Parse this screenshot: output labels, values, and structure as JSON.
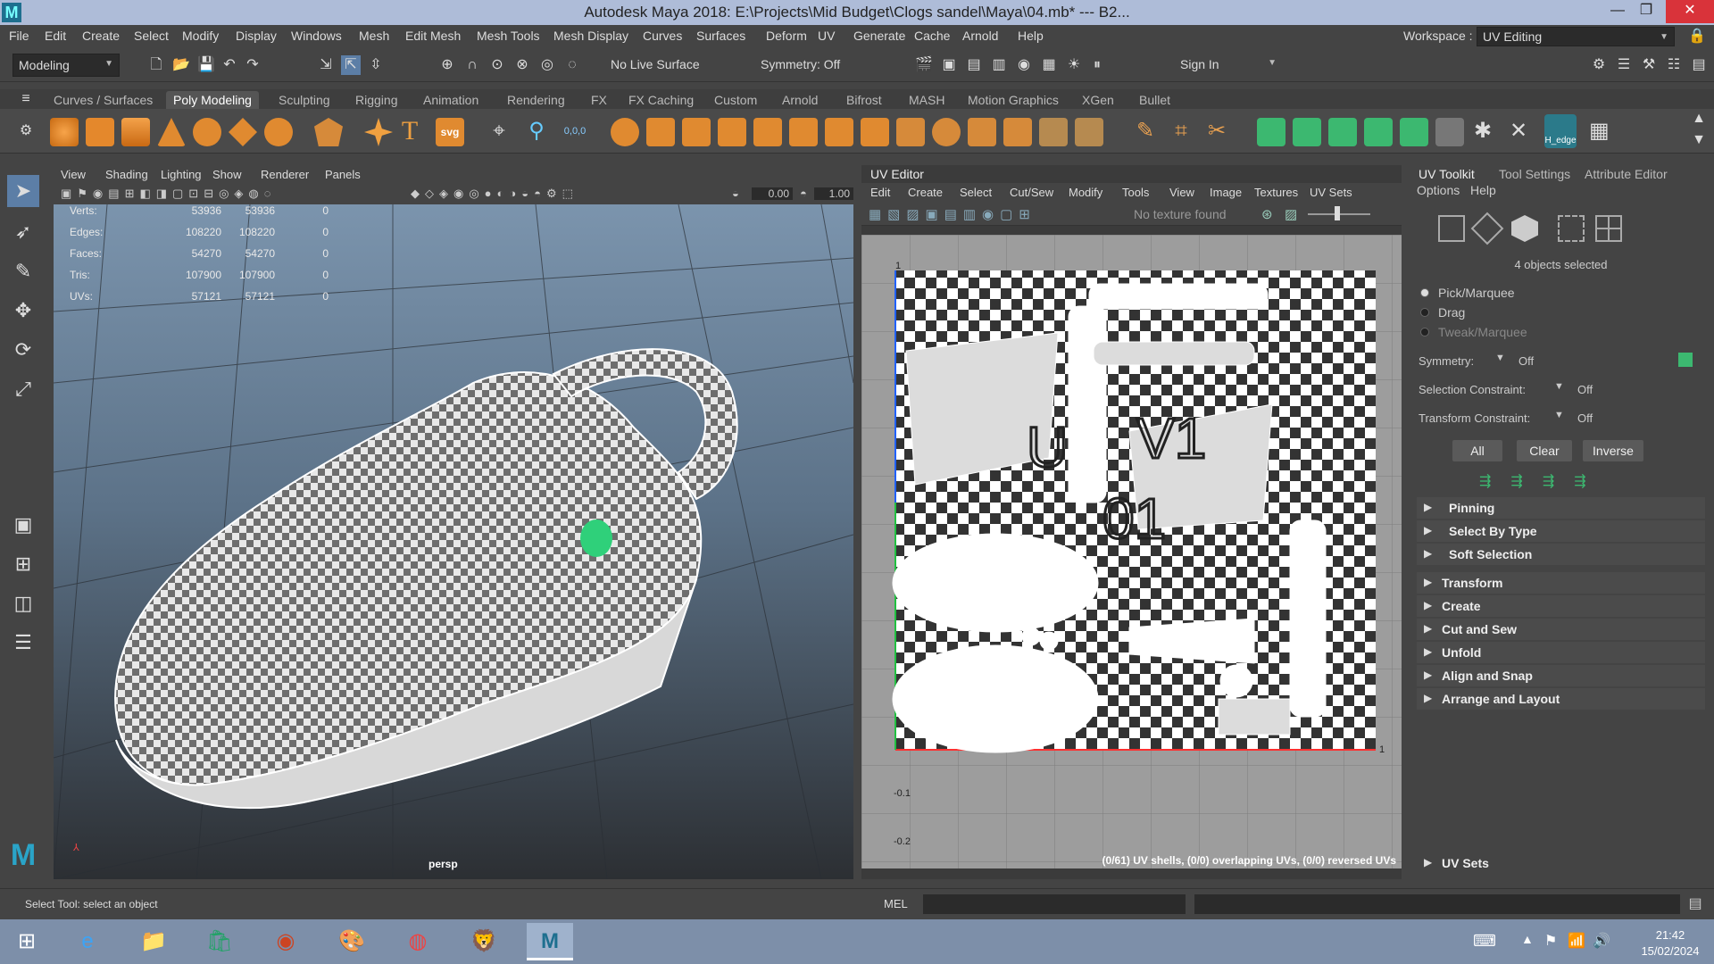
{
  "window": {
    "title": "Autodesk Maya 2018: E:\\Projects\\Mid Budget\\Clogs sandel\\Maya\\04.mb*  ---  B2...",
    "logo": "M",
    "minimize": "—",
    "restore": "❐",
    "close": "✕"
  },
  "menubar": {
    "items": [
      "File",
      "Edit",
      "Create",
      "Select",
      "Modify",
      "Display",
      "Windows",
      "Mesh",
      "Edit Mesh",
      "Mesh Tools",
      "Mesh Display",
      "Curves",
      "Surfaces",
      "Deform",
      "UV",
      "Generate",
      "Cache",
      "Arnold",
      "Help"
    ],
    "workspace_label": "Workspace :",
    "workspace_value": "UV Editing"
  },
  "toolbar": {
    "mode": "Modeling",
    "live_surface": "No Live Surface",
    "symmetry": "Symmetry: Off",
    "sign_in": "Sign In"
  },
  "shelf": {
    "tabs": [
      "Curves / Surfaces",
      "Poly Modeling",
      "Sculpting",
      "Rigging",
      "Animation",
      "Rendering",
      "FX",
      "FX Caching",
      "Custom",
      "Arnold",
      "Bifrost",
      "MASH",
      "Motion Graphics",
      "XGen",
      "Bullet"
    ],
    "active_tab": "Poly Modeling",
    "h_edge_label": "H_edge",
    "svg_label": "svg",
    "coords_label": "0,0,0"
  },
  "viewport": {
    "menu": [
      "View",
      "Shading",
      "Lighting",
      "Show",
      "Renderer",
      "Panels"
    ],
    "field_a": "0.00",
    "field_b": "1.00",
    "hud": [
      {
        "label": "Verts:",
        "a": "53936",
        "b": "53936",
        "c": "0"
      },
      {
        "label": "Edges:",
        "a": "108220",
        "b": "108220",
        "c": "0"
      },
      {
        "label": "Faces:",
        "a": "54270",
        "b": "54270",
        "c": "0"
      },
      {
        "label": "Tris:",
        "a": "107900",
        "b": "107900",
        "c": "0"
      },
      {
        "label": "UVs:",
        "a": "57121",
        "b": "57121",
        "c": "0"
      }
    ],
    "camera": "persp"
  },
  "uv_editor": {
    "title": "UV Editor",
    "menu": [
      "Edit",
      "Create",
      "Select",
      "Cut/Sew",
      "Modify",
      "Tools",
      "View",
      "Image",
      "Textures",
      "UV Sets"
    ],
    "texture_status": "No texture found",
    "axis_1": "1",
    "axis_neg01": "-0.1",
    "axis_neg02": "-0.2",
    "axis_right_1": "1",
    "status": "(0/61) UV shells, (0/0) overlapping UVs, (0/0) reversed UVs",
    "uv_letters": "U",
    "v1_letters": "V1",
    "num_letters": "01"
  },
  "toolkit": {
    "tabs": [
      "UV Toolkit",
      "Tool Settings",
      "Attribute Editor"
    ],
    "menu": [
      "Options",
      "Help"
    ],
    "selected_count": "4 objects selected",
    "modes": [
      "Pick/Marquee",
      "Drag",
      "Tweak/Marquee"
    ],
    "symmetry_label": "Symmetry:",
    "symmetry_value": "Off",
    "sel_constraint_label": "Selection Constraint:",
    "sel_constraint_value": "Off",
    "xform_constraint_label": "Transform Constraint:",
    "xform_constraint_value": "Off",
    "buttons": [
      "All",
      "Clear",
      "Inverse"
    ],
    "sub_sections": [
      "Pinning",
      "Select By Type",
      "Soft Selection"
    ],
    "sections": [
      "Transform",
      "Create",
      "Cut and Sew",
      "Unfold",
      "Align and Snap",
      "Arrange and Layout"
    ],
    "uv_sets": "UV Sets"
  },
  "status": {
    "help_line": "Select Tool: select an object",
    "mel_label": "MEL"
  },
  "taskbar": {
    "time": "21:42",
    "date": "15/02/2024",
    "maya_label": "M"
  },
  "colors": {
    "accent_green": "#2fd07a",
    "titlebar": "#aebcd8",
    "taskbar": "#7d8fa9"
  }
}
